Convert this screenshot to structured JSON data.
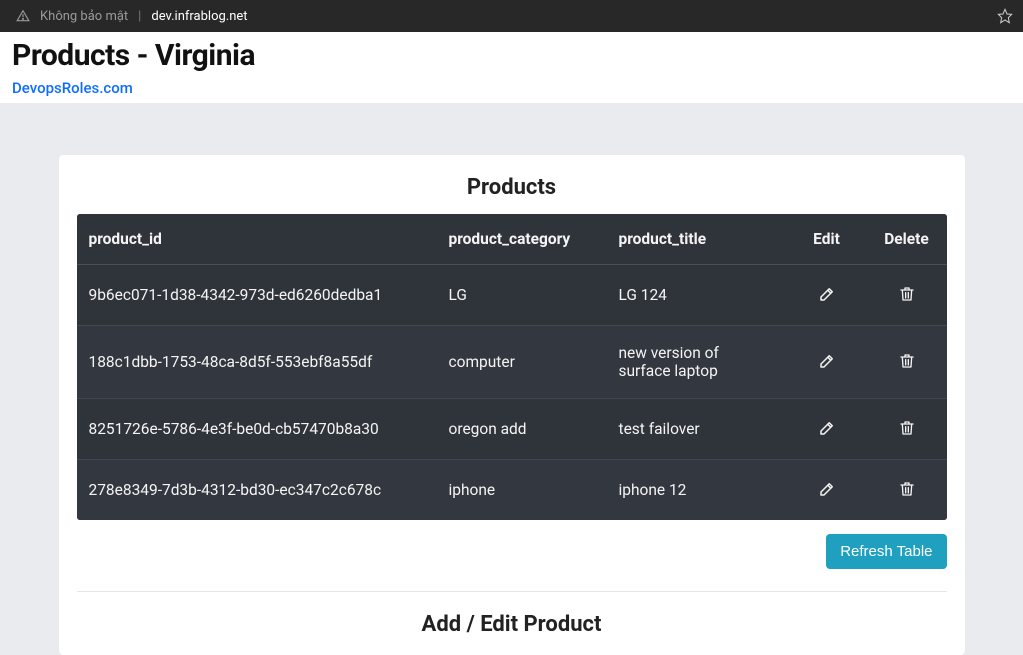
{
  "browser": {
    "security_label": "Không bảo mật",
    "url": "dev.infrablog.net"
  },
  "page": {
    "title": "Products - Virginia",
    "site_link": "DevopsRoles.com"
  },
  "products_section": {
    "title": "Products",
    "headers": {
      "id": "product_id",
      "category": "product_category",
      "title": "product_title",
      "edit": "Edit",
      "delete": "Delete"
    },
    "rows": [
      {
        "id": "9b6ec071-1d38-4342-973d-ed6260dedba1",
        "category": "LG",
        "title": "LG 124"
      },
      {
        "id": "188c1dbb-1753-48ca-8d5f-553ebf8a55df",
        "category": "computer",
        "title": "new version of surface laptop"
      },
      {
        "id": "8251726e-5786-4e3f-be0d-cb57470b8a30",
        "category": "oregon add",
        "title": "test failover"
      },
      {
        "id": "278e8349-7d3b-4312-bd30-ec347c2c678c",
        "category": "iphone",
        "title": "iphone 12"
      }
    ],
    "refresh_label": "Refresh Table"
  },
  "form_section": {
    "title": "Add / Edit Product"
  }
}
